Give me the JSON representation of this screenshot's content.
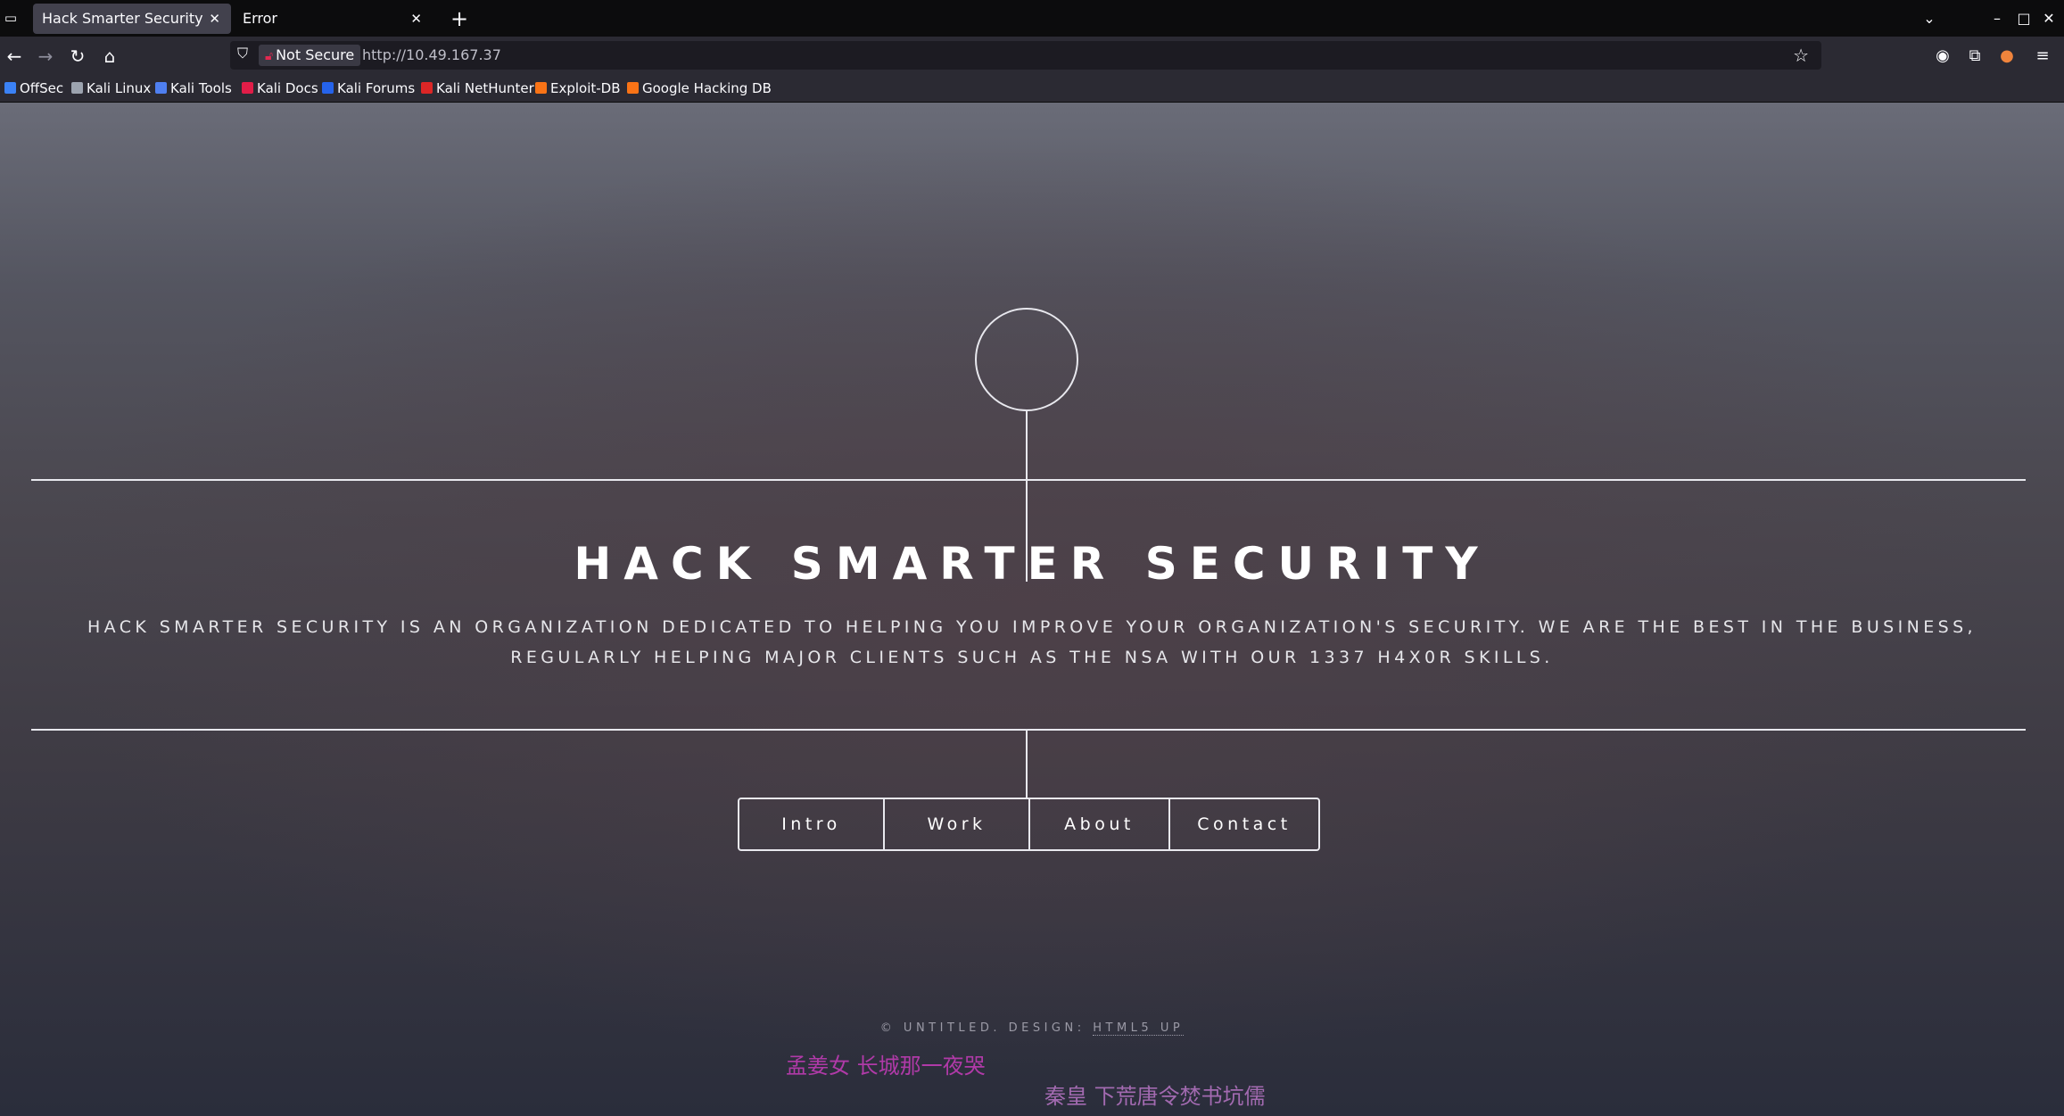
{
  "browser": {
    "tabs": [
      {
        "title": "Hack Smarter Security",
        "active": true
      },
      {
        "title": "Error",
        "active": false
      }
    ],
    "new_tab": "+",
    "window_controls": {
      "chevron": "⌄",
      "minimize": "–",
      "maximize": "□",
      "close": "✕"
    },
    "security_label": "Not Secure",
    "url": "http://10.49.167.37",
    "bookmarks": [
      "OffSec",
      "Kali Linux",
      "Kali Tools",
      "Kali Docs",
      "Kali Forums",
      "Kali NetHunter",
      "Exploit-DB",
      "Google Hacking DB"
    ],
    "bookmark_colors": [
      "#3b82f6",
      "#9ca3af",
      "#4f7ff0",
      "#e11d48",
      "#2563eb",
      "#dc2626",
      "#f97316",
      "#f97316"
    ]
  },
  "page": {
    "title": "HACK SMARTER SECURITY",
    "description": "Hack Smarter Security is an organization dedicated to helping you improve your organization's security. We are the best in the business, regularly helping major clients such as the NSA with our 1337 H4X0R skills.",
    "nav": [
      "Intro",
      "Work",
      "About",
      "Contact"
    ],
    "footer_prefix": "© UNTITLED. DESIGN: ",
    "footer_link": "HTML5 UP",
    "overlay_texts": [
      {
        "text": "孟姜女 长城那一夜哭",
        "color": "#b03aa8"
      },
      {
        "text": "秦皇 下荒唐令焚书坑儒",
        "color": "#a26ab0"
      }
    ]
  }
}
